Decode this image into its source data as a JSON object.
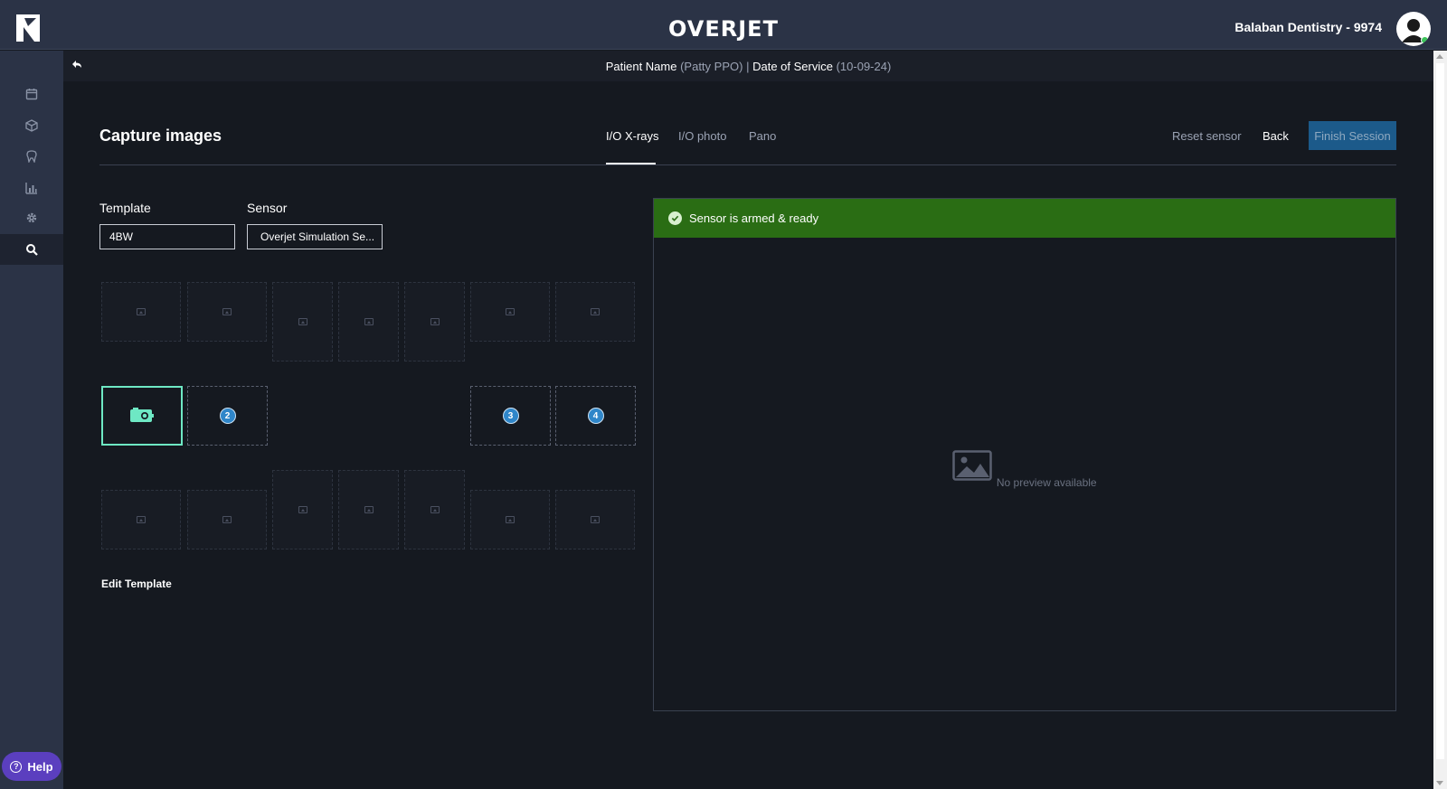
{
  "header": {
    "brand": "OVERJET",
    "practice": "Balaban Dentistry - 9974"
  },
  "subheader": {
    "patient_label": "Patient Name",
    "patient_value": "(Patty PPO)",
    "separator": "|",
    "date_label": "Date of Service",
    "date_value": "(10-09-24)"
  },
  "sidebar": {
    "items": [
      {
        "icon": "calendar-icon"
      },
      {
        "icon": "box-icon"
      },
      {
        "icon": "tooth-icon"
      },
      {
        "icon": "chart-icon"
      },
      {
        "icon": "gear-icon"
      },
      {
        "icon": "search-icon",
        "active": true
      }
    ],
    "help_label": "Help",
    "help_glyph": "?"
  },
  "capture": {
    "title": "Capture images",
    "tabs": [
      {
        "label": "I/O X-rays",
        "active": true
      },
      {
        "label": "I/O photo"
      },
      {
        "label": "Pano"
      }
    ],
    "reset_label": "Reset sensor",
    "back_label": "Back",
    "finish_label": "Finish Session"
  },
  "form": {
    "template_label": "Template",
    "template_value": "4BW",
    "sensor_label": "Sensor",
    "sensor_value": "Overjet Simulation Se..."
  },
  "slots": {
    "badges": [
      "2",
      "3",
      "4"
    ]
  },
  "edit_template_label": "Edit Template",
  "preview": {
    "status_text": "Sensor is armed & ready",
    "empty_text": "No preview available"
  },
  "colors": {
    "accent_teal": "#6ee8c4",
    "status_green": "#2a6d14",
    "finish_blue": "#1c5a8a",
    "badge_blue": "#2f86c9",
    "help_purple": "#5b3fbf"
  }
}
